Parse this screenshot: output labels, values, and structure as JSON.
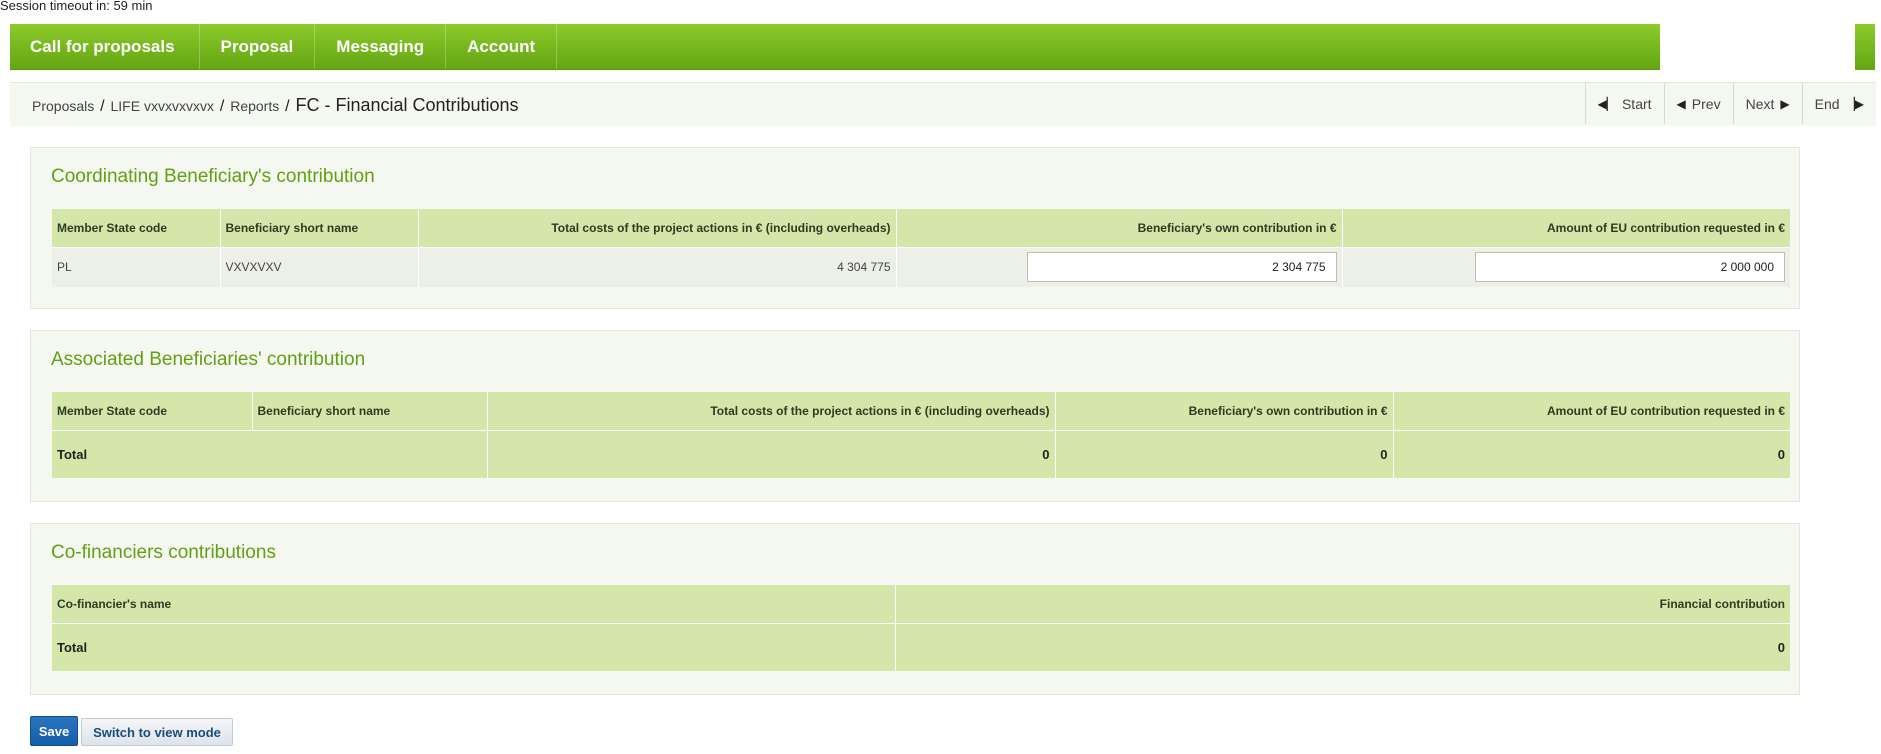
{
  "session": {
    "timeout_text": "Session timeout in: 59 min"
  },
  "nav": {
    "items": [
      {
        "label": "Call for proposals"
      },
      {
        "label": "Proposal"
      },
      {
        "label": "Messaging"
      },
      {
        "label": "Account"
      }
    ]
  },
  "breadcrumb": {
    "items": [
      "Proposals",
      "LIFE vxvxvxvxvx",
      "Reports"
    ],
    "separator": "/",
    "current": "FC - Financial Contributions"
  },
  "pager": {
    "start": "Start",
    "prev": "Prev",
    "next": "Next",
    "end": "End"
  },
  "coordinating": {
    "title": "Coordinating Beneficiary's contribution",
    "headers": {
      "ms_code": "Member State code",
      "short_name": "Beneficiary short name",
      "total_costs": "Total costs of the project actions in € (including overheads)",
      "own_contribution": "Beneficiary's own contribution in €",
      "eu_contribution": "Amount of EU contribution requested in €"
    },
    "row": {
      "ms_code": "PL",
      "short_name": "VXVXVXV",
      "total_costs": "4 304 775",
      "own_contribution": "2 304 775",
      "eu_contribution": "2 000 000"
    }
  },
  "associated": {
    "title": "Associated Beneficiaries' contribution",
    "headers": {
      "ms_code": "Member State code",
      "short_name": "Beneficiary short name",
      "total_costs": "Total costs of the project actions in € (including overheads)",
      "own_contribution": "Beneficiary's own contribution in €",
      "eu_contribution": "Amount of EU contribution requested in €"
    },
    "total": {
      "label": "Total",
      "total_costs": "0",
      "own_contribution": "0",
      "eu_contribution": "0"
    }
  },
  "cofinanciers": {
    "title": "Co-financiers contributions",
    "headers": {
      "name": "Co-financier's name",
      "contribution": "Financial contribution"
    },
    "total": {
      "label": "Total",
      "contribution": "0"
    }
  },
  "actions": {
    "save_label": "Save",
    "view_mode_label": "Switch to view mode"
  }
}
